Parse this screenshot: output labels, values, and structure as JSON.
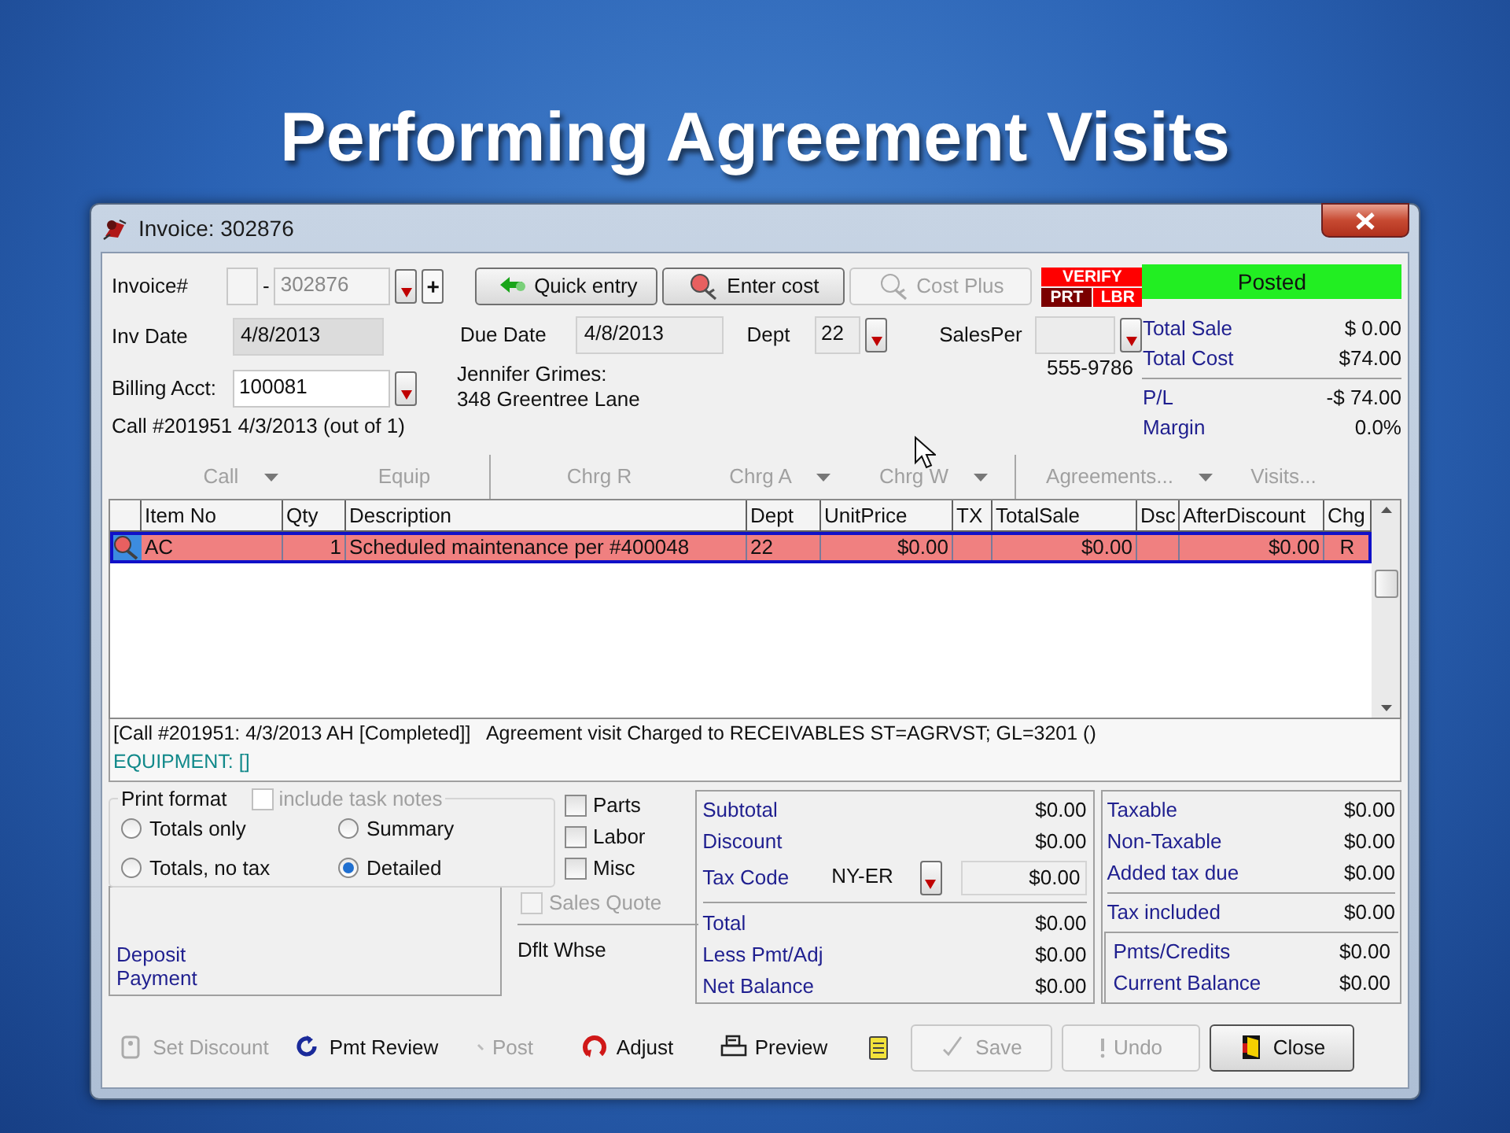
{
  "slide_title": "Performing Agreement Visits",
  "window": {
    "title": "Invoice: 302876"
  },
  "header": {
    "invoice_label": "Invoice#",
    "separator": "-",
    "invoice_number": "302876",
    "add_button": "+",
    "inv_date_label": "Inv Date",
    "inv_date": "4/8/2013",
    "billing_label": "Billing Acct:",
    "billing_acct": "100081",
    "call_info": "Call #201951 4/3/2013 (out of 1)",
    "due_date_label": "Due Date",
    "due_date": "4/8/2013",
    "dept_label": "Dept",
    "dept": "22",
    "salesper_label": "SalesPer",
    "customer_lines": [
      "Jennifer Grimes:",
      "348 Greentree Lane"
    ],
    "phone": "555-9786"
  },
  "actions": [
    {
      "label": "Quick entry",
      "disabled": false
    },
    {
      "label": "Enter cost",
      "disabled": false
    },
    {
      "label": "Cost Plus",
      "disabled": true
    }
  ],
  "flags": [
    {
      "label": "VERIFY",
      "color": "#ff0000"
    },
    {
      "label": "PRT",
      "color": "#7a0000"
    },
    {
      "label": "LBR",
      "color": "#ff0000"
    }
  ],
  "status": "Posted",
  "summary": [
    {
      "label": "Total Sale",
      "value": "$ 0.00"
    },
    {
      "label": "Total Cost",
      "value": "$74.00"
    },
    {
      "label": "P/L",
      "value": "-$ 74.00"
    },
    {
      "label": "Margin",
      "value": "0.0%"
    }
  ],
  "toolbar": [
    {
      "kind": "button",
      "label": "Call",
      "dropdown": true,
      "disabled": true
    },
    {
      "kind": "button",
      "label": "Equip",
      "dropdown": false,
      "disabled": true
    },
    {
      "kind": "separator"
    },
    {
      "kind": "button",
      "label": "Chrg R",
      "dropdown": false,
      "disabled": true
    },
    {
      "kind": "button",
      "label": "Chrg A",
      "dropdown": true,
      "disabled": true
    },
    {
      "kind": "button",
      "label": "Chrg W",
      "dropdown": true,
      "disabled": true
    },
    {
      "kind": "separator"
    },
    {
      "kind": "button",
      "label": "Agreements...",
      "dropdown": true,
      "disabled": true
    },
    {
      "kind": "button",
      "label": "Visits...",
      "dropdown": false,
      "disabled": true
    }
  ],
  "table": {
    "columns": [
      "Item No",
      "Qty",
      "Description",
      "Dept",
      "UnitPrice",
      "TX",
      "TotalSale",
      "Dsc",
      "AfterDiscount",
      "Chg"
    ],
    "rows": [
      {
        "selected": true,
        "cells": [
          "AC",
          "1",
          "Scheduled maintenance per #400048",
          "22",
          "$0.00",
          null,
          "$0.00",
          null,
          "$0.00",
          "R"
        ]
      }
    ]
  },
  "notes": [
    {
      "kind": "call",
      "text": "[Call #201951: 4/3/2013 AH [Completed]]   Agreement visit Charged to RECEIVABLES ST=AGRVST; GL=3201 ()"
    },
    {
      "kind": "equipment",
      "text": "EQUIPMENT: []"
    }
  ],
  "print_format": {
    "label": "Print format",
    "task_notes": {
      "label": "include task notes",
      "checked": false,
      "disabled": true
    },
    "options": [
      {
        "label": "Totals only",
        "selected": false
      },
      {
        "label": "Summary",
        "selected": false
      },
      {
        "label": "Totals, no tax",
        "selected": false
      },
      {
        "label": "Detailed",
        "selected": true
      }
    ]
  },
  "include_checks": [
    {
      "label": "Parts",
      "checked": false
    },
    {
      "label": "Labor",
      "checked": false
    },
    {
      "label": "Misc",
      "checked": false
    }
  ],
  "sales_quote": {
    "label": "Sales Quote",
    "checked": false,
    "disabled": true
  },
  "deposit_lines": [
    "Deposit",
    "Payment"
  ],
  "dflt_whse": "Dflt Whse",
  "totals": {
    "top": [
      {
        "label": "Subtotal",
        "value": "$0.00"
      },
      {
        "label": "Discount",
        "value": "$0.00"
      }
    ],
    "tax_code_label": "Tax Code",
    "tax_code": "NY-ER",
    "tax_amount": "$0.00",
    "bottom": [
      {
        "label": "Total",
        "value": "$0.00"
      },
      {
        "label": "Less Pmt/Adj",
        "value": "$0.00"
      },
      {
        "label": "Net Balance",
        "value": "$0.00"
      }
    ]
  },
  "tax": {
    "top": [
      {
        "label": "Taxable",
        "value": "$0.00"
      },
      {
        "label": "Non-Taxable",
        "value": "$0.00"
      },
      {
        "label": "Added tax due",
        "value": "$0.00"
      }
    ],
    "included": {
      "label": "Tax included",
      "value": "$0.00"
    },
    "payments": [
      {
        "label": "Pmts/Credits",
        "value": "$0.00"
      },
      {
        "label": "Current Balance",
        "value": "$0.00"
      }
    ]
  },
  "footer": [
    {
      "kind": "plain",
      "label": "Set Discount",
      "disabled": true
    },
    {
      "kind": "plain",
      "label": "Pmt Review",
      "disabled": false
    },
    {
      "kind": "plain",
      "label": "Post",
      "disabled": true
    },
    {
      "kind": "plain",
      "label": "Adjust",
      "disabled": false
    },
    {
      "kind": "plain",
      "label": "Preview",
      "disabled": false
    },
    {
      "kind": "icon",
      "disabled": false
    },
    {
      "kind": "boxed",
      "label": "Save",
      "disabled": true
    },
    {
      "kind": "boxed",
      "label": "Undo",
      "disabled": true
    },
    {
      "kind": "boxed",
      "label": "Close",
      "disabled": false
    }
  ]
}
